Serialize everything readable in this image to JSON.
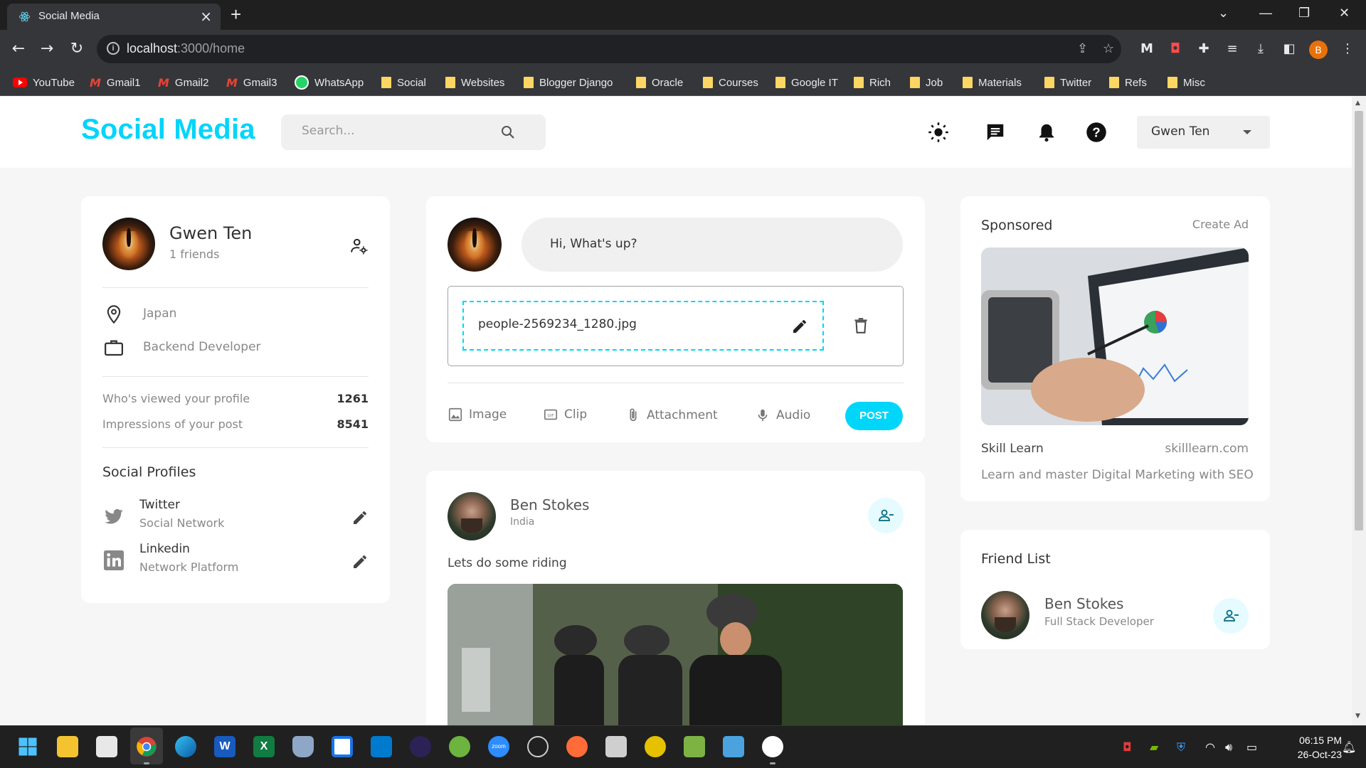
{
  "browser": {
    "tab_title": "Social Media",
    "url_host": "localhost",
    "url_path": ":3000/home",
    "bookmarks": [
      "YouTube",
      "Gmail1",
      "Gmail2",
      "Gmail3",
      "WhatsApp",
      "Social",
      "Websites",
      "Blogger Django",
      "Oracle",
      "Courses",
      "Google IT",
      "Rich",
      "Job",
      "Materials",
      "Twitter",
      "Refs",
      "Misc"
    ],
    "profile_initial": "B"
  },
  "navbar": {
    "logo": "Social Media",
    "search_placeholder": "Search...",
    "user_name": "Gwen Ten"
  },
  "profile": {
    "name": "Gwen Ten",
    "friends": "1 friends",
    "location": "Japan",
    "occupation": "Backend Developer",
    "viewed_label": "Who's viewed your profile",
    "viewed_value": "1261",
    "impressions_label": "Impressions of your post",
    "impressions_value": "8541",
    "social_title": "Social Profiles",
    "socials": [
      {
        "name": "Twitter",
        "type": "Social Network"
      },
      {
        "name": "Linkedin",
        "type": "Network Platform"
      }
    ]
  },
  "composer": {
    "placeholder": "Hi, What's up?",
    "file_name": "people-2569234_1280.jpg",
    "actions": [
      "Image",
      "Clip",
      "Attachment",
      "Audio"
    ],
    "post_label": "POST"
  },
  "post": {
    "author": "Ben Stokes",
    "location": "India",
    "description": "Lets do some riding"
  },
  "sponsored": {
    "title": "Sponsored",
    "create_ad": "Create Ad",
    "company": "Skill Learn",
    "website": "skilllearn.com",
    "description": "Learn and master Digital Marketing with SEO"
  },
  "friend_list": {
    "title": "Friend List",
    "friends": [
      {
        "name": "Ben Stokes",
        "occupation": "Full Stack Developer"
      }
    ]
  },
  "taskbar": {
    "time": "06:15 PM",
    "date": "26-Oct-23"
  },
  "colors": {
    "primary": "#00d5fa",
    "primary_light": "#e6fbff",
    "background": "#f6f6f6",
    "card": "#ffffff"
  }
}
